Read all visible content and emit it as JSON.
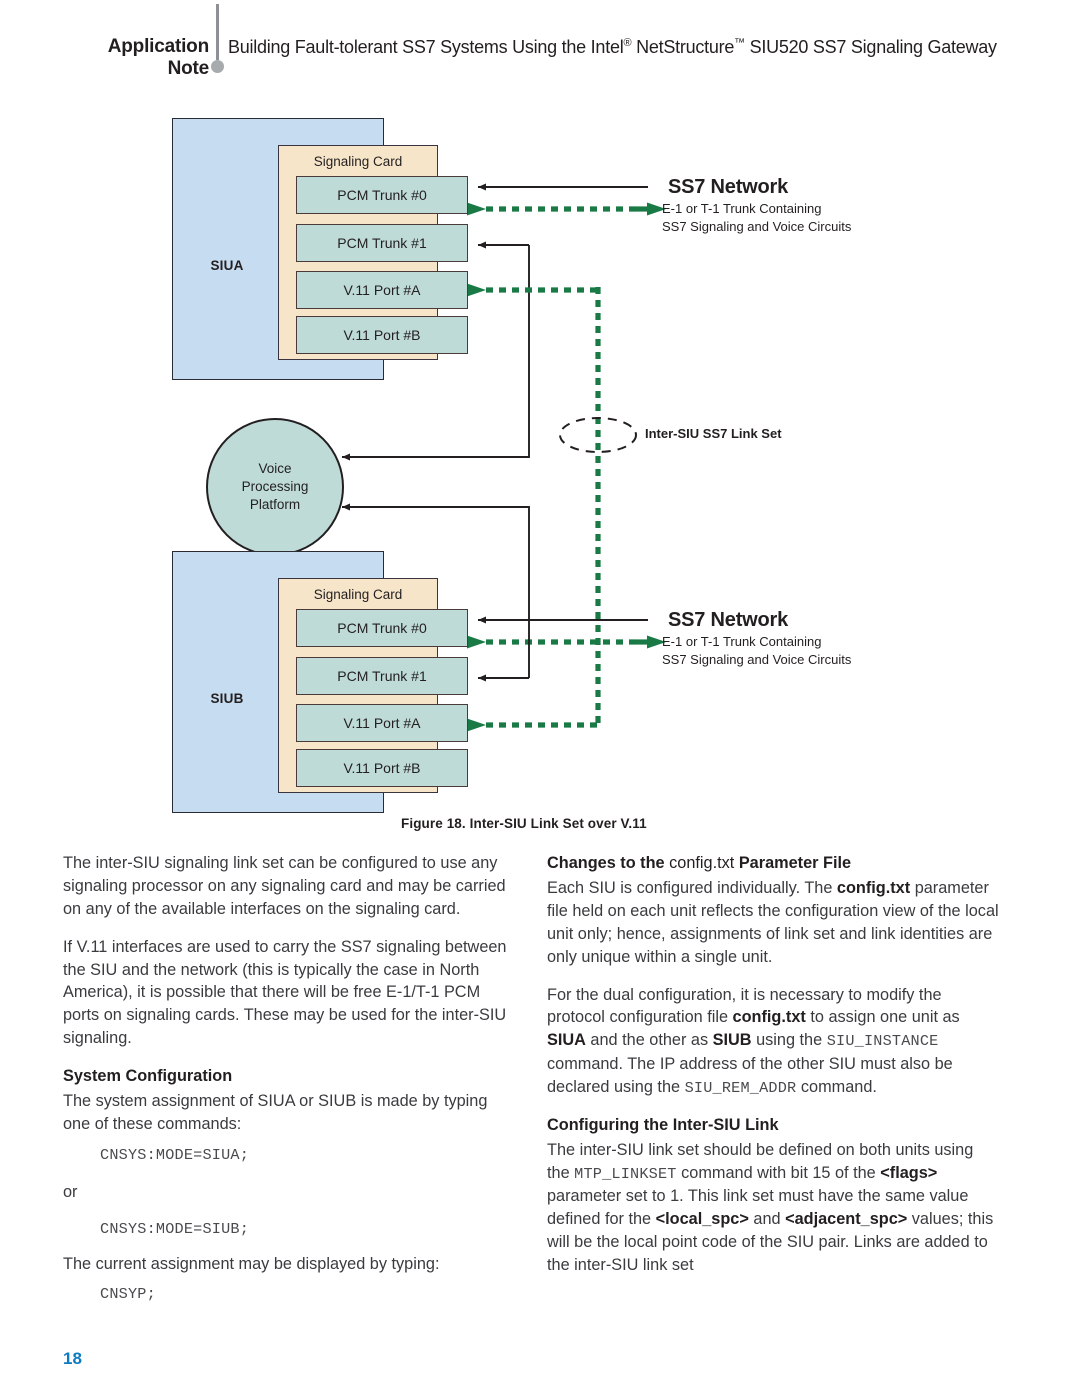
{
  "header": {
    "strong": "Application Note",
    "rest_pre": "Building Fault-tolerant SS7 Systems Using the Intel",
    "rest_reg": "®",
    "rest_mid": " NetStructure",
    "rest_tm": "™",
    "rest_post": " SIU520 SS7 Signaling Gateway"
  },
  "figure": {
    "caption": "Figure 18. Inter-SIU Link Set over V.11",
    "linkset_label": "Inter-SIU SS7 Link Set",
    "vpp_label": "Voice\nProcessing\nPlatform",
    "units": [
      {
        "name": "SIUA",
        "card_title": "Signaling Card",
        "ports": [
          "PCM Trunk #0",
          "PCM Trunk #1",
          "V.11 Port #A",
          "V.11 Port #B"
        ]
      },
      {
        "name": "SIUB",
        "card_title": "Signaling Card",
        "ports": [
          "PCM Trunk #0",
          "PCM Trunk #1",
          "V.11 Port #A",
          "V.11 Port #B"
        ]
      }
    ],
    "networks": [
      {
        "title": "SS7 Network",
        "sub_line1": "E-1 or T-1 Trunk Containing",
        "sub_line2": "SS7 Signaling and Voice Circuits"
      },
      {
        "title": "SS7 Network",
        "sub_line1": "E-1 or T-1 Trunk Containing",
        "sub_line2": "SS7 Signaling and Voice Circuits"
      }
    ],
    "colors": {
      "unit_fill": "#c6dcf0",
      "card_fill": "#f6e5c9",
      "port_fill": "#bedbd7",
      "green_link": "#1a7a46",
      "line": "#231f20"
    }
  },
  "body": {
    "left": {
      "para1": "The inter-SIU signaling link set can be configured to use any signaling processor on any signaling card and may be carried on any of the available interfaces on the signaling card.",
      "para2": "If V.11 interfaces are used to carry the SS7 signaling between the SIU and the network (this is typically the case in North America), it is possible that there will be free E-1/T-1 PCM ports on signaling cards. These may be used for the inter-SIU signaling.",
      "heading": "System Configuration",
      "para3": "The system assignment of SIUA or SIUB is made by typing one of these commands:",
      "cmd1": "CNSYS:MODE=SIUA;",
      "or": "or",
      "cmd2": "CNSYS:MODE=SIUB;",
      "para4": "The current assignment may be displayed by typing:",
      "cmd3": "CNSYP;"
    },
    "right": {
      "heading1_a": "Changes to the ",
      "heading1_mono": "config.txt",
      "heading1_b": " Parameter File",
      "p1_a": "Each SIU is configured individually. The ",
      "p1_b": "config.txt",
      "p1_c": " parameter file held on each unit reflects the configuration view of the local unit only; hence, assignments of link set and link identities are only unique within a single unit.",
      "p2_a": "For the dual configuration, it is necessary to modify the protocol configuration file ",
      "p2_b": "config.txt",
      "p2_c": " to assign one unit as ",
      "p2_d": "SIUA",
      "p2_e": " and the other as ",
      "p2_f": "SIUB",
      "p2_g": " using the ",
      "p2_mono1": "SIU_INSTANCE",
      "p2_h": " command. The IP address of the other SIU must also be declared using the ",
      "p2_mono2": "SIU_REM_ADDR",
      "p2_i": " command.",
      "heading2": "Configuring the Inter-SIU Link",
      "p3_a": "The inter-SIU link set should be defined on both units using the ",
      "p3_mono": "MTP_LINKSET",
      "p3_b": " command with bit 15 of the ",
      "p3_c": "<flags>",
      "p3_d": " parameter set to 1. This link set must have the same value defined for the ",
      "p3_e": "<local_spc>",
      "p3_f": " and ",
      "p3_g": "<adjacent_spc>",
      "p3_h": " values; this will be the local point code of the SIU pair. Links are added to the inter-SIU link set"
    }
  },
  "footer": {
    "page_number": "18"
  }
}
